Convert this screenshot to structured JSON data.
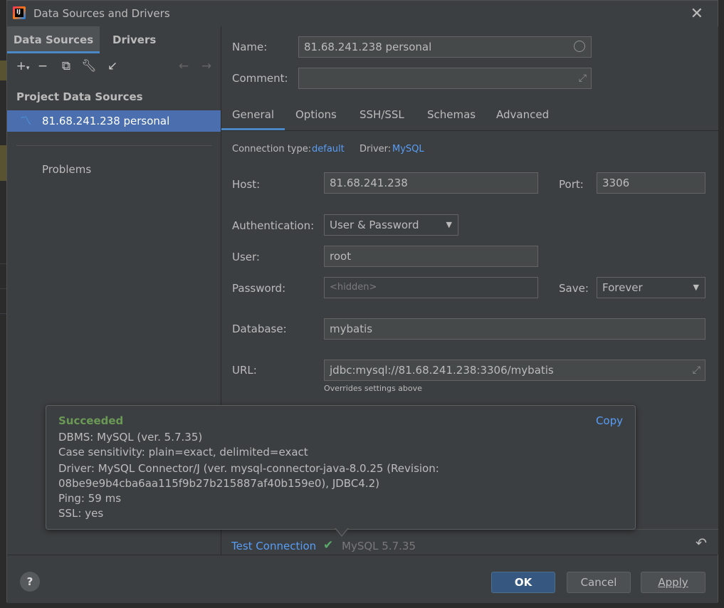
{
  "window": {
    "title": "Data Sources and Drivers"
  },
  "left": {
    "tabs": [
      "Data Sources",
      "Drivers"
    ],
    "section_title": "Project Data Sources",
    "data_source": "81.68.241.238 personal",
    "problems": "Problems"
  },
  "form": {
    "name_label": "Name:",
    "name_value": "81.68.241.238 personal",
    "comment_label": "Comment:",
    "comment_value": "",
    "tabs": [
      "General",
      "Options",
      "SSH/SSL",
      "Schemas",
      "Advanced"
    ],
    "conn_type_label": "Connection type:",
    "conn_type_value": "default",
    "driver_label": "Driver:",
    "driver_value": "MySQL",
    "host_label": "Host:",
    "host_value": "81.68.241.238",
    "port_label": "Port:",
    "port_value": "3306",
    "auth_label": "Authentication:",
    "auth_value": "User & Password",
    "user_label": "User:",
    "user_value": "root",
    "password_label": "Password:",
    "password_placeholder": "<hidden>",
    "save_label": "Save:",
    "save_value": "Forever",
    "database_label": "Database:",
    "database_value": "mybatis",
    "url_label": "URL:",
    "url_value": "jdbc:mysql://81.68.241.238:3306/mybatis",
    "url_hint": "Overrides settings above"
  },
  "popup": {
    "status": "Succeeded",
    "copy": "Copy",
    "lines": [
      "DBMS: MySQL (ver. 5.7.35)",
      "Case sensitivity: plain=exact, delimited=exact",
      "Driver: MySQL Connector/J (ver. mysql-connector-java-8.0.25 (Revision:",
      "08be9e9b4cba6aa115f9b27b215887af40b159e0), JDBC4.2)",
      "Ping: 59 ms",
      "SSL: yes"
    ]
  },
  "test": {
    "label": "Test Connection",
    "result": "MySQL 5.7.35"
  },
  "footer": {
    "help": "?",
    "ok": "OK",
    "cancel": "Cancel",
    "apply": "Apply"
  },
  "colors": {
    "accent": "#4a88c7",
    "link": "#589df6",
    "selection": "#4b6eaf",
    "success": "#6a9955"
  }
}
